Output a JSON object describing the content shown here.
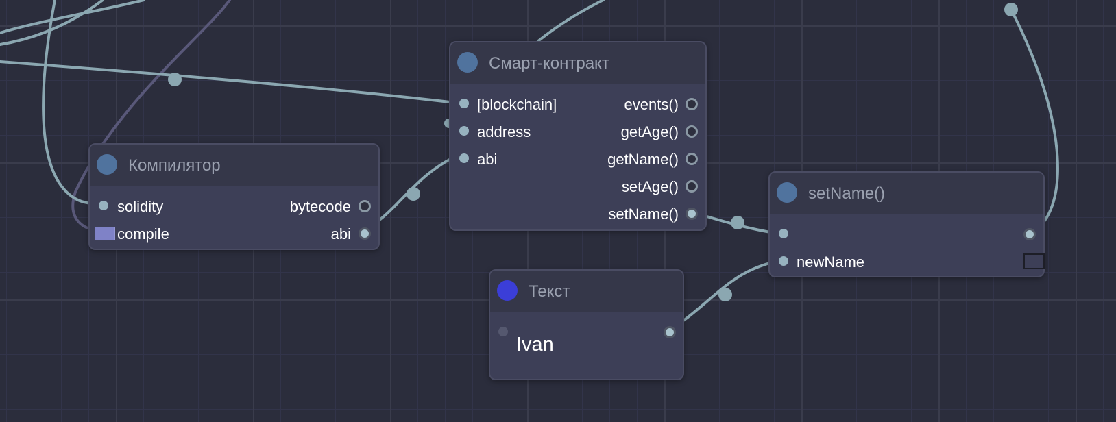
{
  "nodes": {
    "compiler": {
      "title": "Компилятор",
      "inputs": [
        "solidity",
        "compile"
      ],
      "outputs": [
        "bytecode",
        "abi"
      ]
    },
    "contract": {
      "title": "Смарт-контракт",
      "inputs": [
        "[blockchain]",
        "address",
        "abi"
      ],
      "outputs": [
        "events()",
        "getAge()",
        "getName()",
        "setAge()",
        "setName()"
      ]
    },
    "setname": {
      "title": "setName()",
      "inputs": [
        "",
        "newName"
      ]
    },
    "text": {
      "title": "Текст",
      "value": "Ivan"
    }
  },
  "colors": {
    "background": "#2b2d3c",
    "node_body": "#3d3f57",
    "node_header": "#353749",
    "wire": "#8ba7b1",
    "wire_dim": "#595879",
    "node_dot": "#50739e",
    "text_node_dot": "#3b3ed8",
    "exec_port": "#7f82c7"
  }
}
